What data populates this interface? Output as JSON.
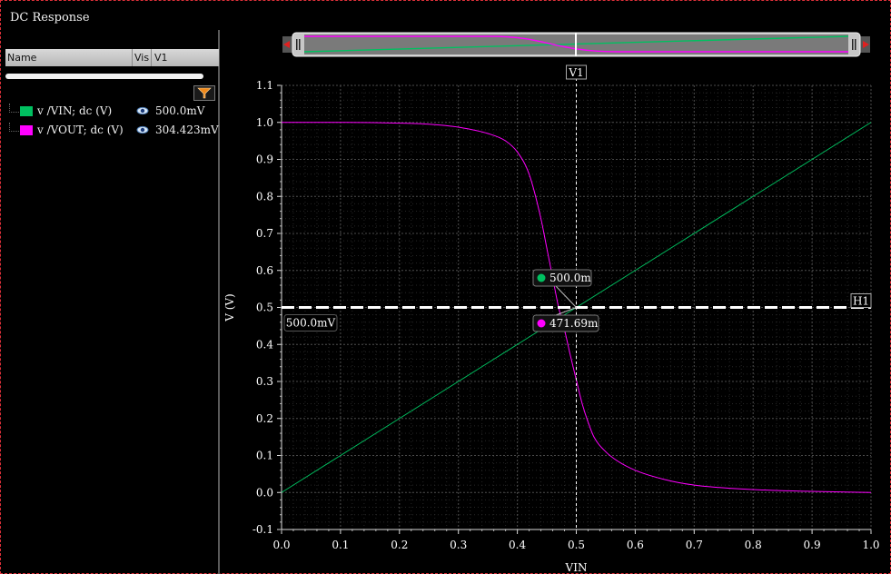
{
  "window": {
    "title": "DC Response"
  },
  "legend": {
    "columns": [
      "Name",
      "Vis",
      "V1"
    ],
    "items": [
      {
        "label": "v /VIN; dc (V)",
        "value": "500.0mV",
        "color": "#00c060",
        "icon": "eye-icon"
      },
      {
        "label": "v /VOUT; dc (V)",
        "value": "304.423mV",
        "color": "#ff00ff",
        "icon": "eye-icon"
      }
    ],
    "filter_icon": "filter-icon"
  },
  "markers": {
    "v1_label": "V1",
    "h1_label": "H1",
    "h1_value": "500.0mV",
    "point_vin": "500.0m",
    "point_vout": "471.69m"
  },
  "chart_data": {
    "type": "line",
    "xlabel": "VIN",
    "ylabel": "V (V)",
    "xlim": [
      0,
      1.0
    ],
    "ylim": [
      -0.1,
      1.1
    ],
    "xticks": [
      "0.0",
      "0.1",
      "0.2",
      "0.3",
      "0.4",
      "0.5",
      "0.6",
      "0.7",
      "0.8",
      "0.9",
      "1.0"
    ],
    "yticks": [
      "-0.1",
      "0.0",
      "0.1",
      "0.2",
      "0.3",
      "0.4",
      "0.5",
      "0.6",
      "0.7",
      "0.8",
      "0.9",
      "1.0",
      "1.1"
    ],
    "grid": true,
    "cursor_x": 0.5,
    "cursor_y": 0.5,
    "series": [
      {
        "name": "v /VIN; dc (V)",
        "color": "#00c060",
        "x": [
          0.0,
          0.1,
          0.2,
          0.3,
          0.4,
          0.5,
          0.6,
          0.7,
          0.8,
          0.9,
          1.0
        ],
        "y": [
          0.0,
          0.1,
          0.2,
          0.3,
          0.4,
          0.5,
          0.6,
          0.7,
          0.8,
          0.9,
          1.0
        ]
      },
      {
        "name": "v /VOUT; dc (V)",
        "color": "#ff00ff",
        "x": [
          0.0,
          0.1,
          0.2,
          0.25,
          0.3,
          0.35,
          0.38,
          0.4,
          0.42,
          0.44,
          0.45,
          0.46,
          0.47,
          0.48,
          0.49,
          0.5,
          0.51,
          0.52,
          0.53,
          0.55,
          0.57,
          0.6,
          0.65,
          0.7,
          0.8,
          0.9,
          1.0
        ],
        "y": [
          1.0,
          1.0,
          0.998,
          0.995,
          0.987,
          0.97,
          0.95,
          0.92,
          0.86,
          0.74,
          0.66,
          0.58,
          0.5,
          0.44,
          0.37,
          0.304,
          0.24,
          0.19,
          0.15,
          0.11,
          0.085,
          0.06,
          0.035,
          0.02,
          0.008,
          0.003,
          0.0
        ]
      }
    ]
  }
}
